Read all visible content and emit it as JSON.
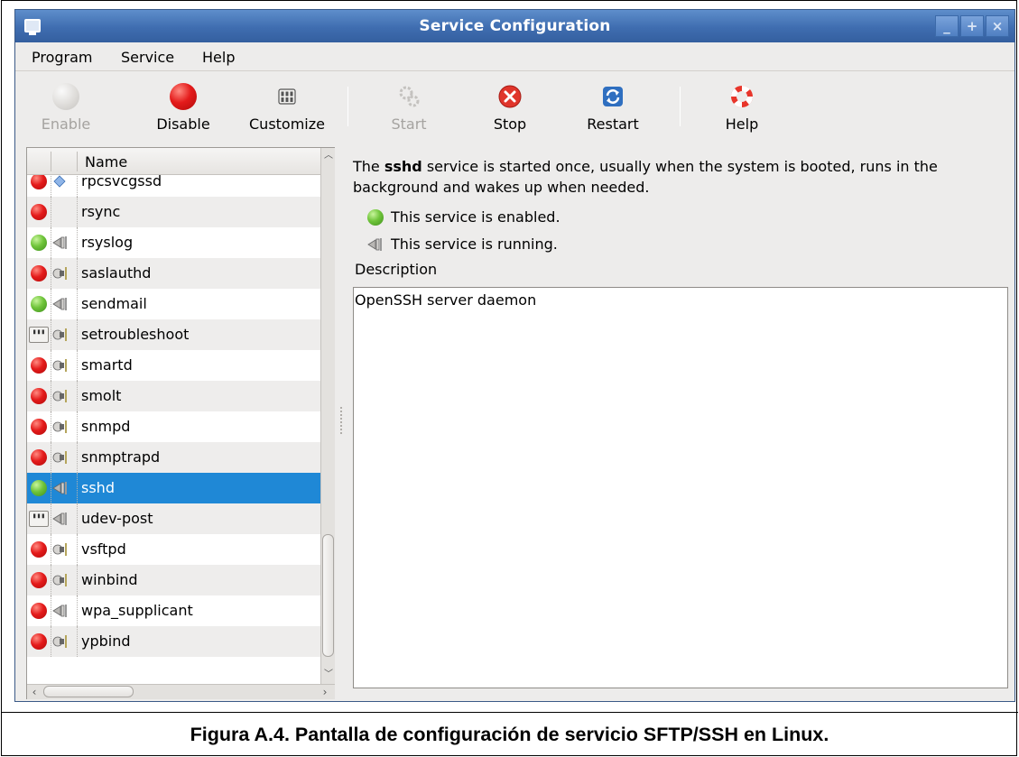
{
  "window": {
    "title": "Service Configuration",
    "controls": [
      "_",
      "+",
      "×"
    ]
  },
  "menu": [
    "Program",
    "Service",
    "Help"
  ],
  "toolbar": {
    "enable": "Enable",
    "disable": "Disable",
    "customize": "Customize",
    "start": "Start",
    "stop": "Stop",
    "restart": "Restart",
    "help": "Help"
  },
  "list": {
    "header": "Name",
    "rows": [
      {
        "name": "rpcsvcgssd",
        "status": "red",
        "run": "diamond"
      },
      {
        "name": "rsync",
        "status": "red",
        "run": "none"
      },
      {
        "name": "rsyslog",
        "status": "green",
        "run": "running"
      },
      {
        "name": "saslauthd",
        "status": "red",
        "run": "stopped"
      },
      {
        "name": "sendmail",
        "status": "green",
        "run": "running"
      },
      {
        "name": "setroubleshoot",
        "status": "custom",
        "run": "stopped"
      },
      {
        "name": "smartd",
        "status": "red",
        "run": "stopped"
      },
      {
        "name": "smolt",
        "status": "red",
        "run": "stopped"
      },
      {
        "name": "snmpd",
        "status": "red",
        "run": "stopped"
      },
      {
        "name": "snmptrapd",
        "status": "red",
        "run": "stopped"
      },
      {
        "name": "sshd",
        "status": "green",
        "run": "running",
        "selected": true
      },
      {
        "name": "udev-post",
        "status": "custom",
        "run": "running"
      },
      {
        "name": "vsftpd",
        "status": "red",
        "run": "stopped"
      },
      {
        "name": "winbind",
        "status": "red",
        "run": "stopped"
      },
      {
        "name": "wpa_supplicant",
        "status": "red",
        "run": "running"
      },
      {
        "name": "ypbind",
        "status": "red",
        "run": "stopped"
      }
    ]
  },
  "detail": {
    "intro_prefix": "The ",
    "service_name": "sshd",
    "intro_suffix": " service is started once, usually when the system is booted, runs in the background and wakes up when needed.",
    "enabled_text": "This service is enabled.",
    "running_text": "This service is running.",
    "description_label": "Description",
    "description": "OpenSSH server daemon"
  },
  "caption": "Figura A.4. Pantalla de configuración de servicio SFTP/SSH en Linux.",
  "colors": {
    "titlebar": "#3f6db0",
    "selection": "#1f88d6",
    "enabled": "#6fc43a",
    "disabled": "#e41b1b"
  }
}
